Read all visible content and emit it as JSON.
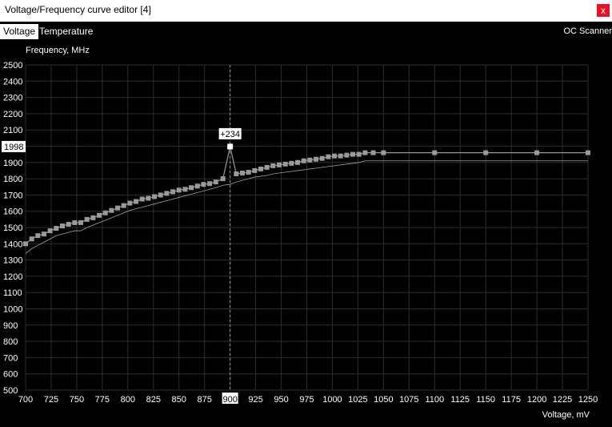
{
  "window": {
    "title": "Voltage/Frequency curve editor [4]",
    "close_label": "x"
  },
  "tabs": [
    {
      "label": "Voltage"
    },
    {
      "label": "Temperature"
    }
  ],
  "oc_scanner_label": "OC Scanner",
  "chart_data": {
    "type": "line",
    "ylabel": "Frequency, MHz",
    "xlabel": "Voltage, mV",
    "xlim": [
      700,
      1250
    ],
    "ylim": [
      500,
      2500
    ],
    "x_ticks": [
      700,
      725,
      750,
      775,
      800,
      825,
      850,
      875,
      900,
      925,
      950,
      975,
      1000,
      1025,
      1050,
      1075,
      1100,
      1125,
      1150,
      1175,
      1200,
      1225,
      1250
    ],
    "y_ticks": [
      500,
      600,
      700,
      800,
      900,
      1000,
      1100,
      1200,
      1300,
      1400,
      1500,
      1600,
      1700,
      1800,
      1900,
      2000,
      2100,
      2200,
      2300,
      2400,
      2500
    ],
    "grid": true,
    "selected_voltage": 900,
    "selected_frequency": 1998,
    "selected_frequency_label": "1998",
    "selected_voltage_label": "900",
    "offset_label": "+234",
    "colors": {
      "edited": "#9a9a9a",
      "default": "#a0a0a0",
      "grid": "#2e2e2e",
      "cursor": "#9a9a9a"
    },
    "series": [
      {
        "role": "edited",
        "x": [
          700,
          706,
          712,
          718,
          724,
          730,
          736,
          742,
          748,
          754,
          760,
          766,
          772,
          778,
          784,
          790,
          796,
          802,
          808,
          814,
          820,
          826,
          832,
          838,
          844,
          850,
          856,
          862,
          868,
          874,
          880,
          886,
          893,
          900,
          906,
          912,
          918,
          924,
          930,
          936,
          942,
          948,
          954,
          960,
          966,
          972,
          978,
          984,
          990,
          996,
          1002,
          1008,
          1014,
          1020,
          1026,
          1032,
          1040,
          1050,
          1100,
          1150,
          1200,
          1250
        ],
        "y": [
          1400,
          1430,
          1450,
          1460,
          1480,
          1495,
          1510,
          1520,
          1530,
          1530,
          1550,
          1560,
          1575,
          1590,
          1605,
          1620,
          1635,
          1650,
          1660,
          1675,
          1680,
          1690,
          1700,
          1710,
          1720,
          1730,
          1735,
          1745,
          1755,
          1765,
          1770,
          1780,
          1800,
          1998,
          1830,
          1835,
          1840,
          1850,
          1860,
          1870,
          1880,
          1885,
          1890,
          1895,
          1900,
          1910,
          1915,
          1920,
          1925,
          1935,
          1940,
          1940,
          1945,
          1950,
          1950,
          1960,
          1960,
          1960,
          1960,
          1960,
          1960,
          1960
        ]
      },
      {
        "role": "default",
        "x": [
          700,
          706,
          712,
          718,
          724,
          730,
          736,
          742,
          748,
          754,
          760,
          766,
          772,
          778,
          784,
          790,
          796,
          802,
          808,
          814,
          820,
          826,
          832,
          838,
          844,
          850,
          856,
          862,
          868,
          874,
          880,
          886,
          893,
          900,
          906,
          912,
          918,
          924,
          930,
          936,
          942,
          948,
          954,
          960,
          966,
          972,
          978,
          984,
          990,
          996,
          1002,
          1008,
          1014,
          1020,
          1026,
          1032,
          1040,
          1050,
          1100,
          1150,
          1200,
          1250
        ],
        "y": [
          1340,
          1370,
          1390,
          1410,
          1430,
          1450,
          1460,
          1470,
          1480,
          1480,
          1500,
          1515,
          1530,
          1545,
          1560,
          1575,
          1590,
          1605,
          1615,
          1625,
          1635,
          1645,
          1655,
          1665,
          1675,
          1685,
          1695,
          1705,
          1715,
          1725,
          1735,
          1745,
          1760,
          1765,
          1780,
          1790,
          1800,
          1810,
          1815,
          1820,
          1830,
          1835,
          1840,
          1845,
          1850,
          1855,
          1860,
          1865,
          1870,
          1875,
          1880,
          1885,
          1890,
          1895,
          1900,
          1910,
          1910,
          1910,
          1910,
          1910,
          1910,
          1910
        ]
      }
    ]
  }
}
